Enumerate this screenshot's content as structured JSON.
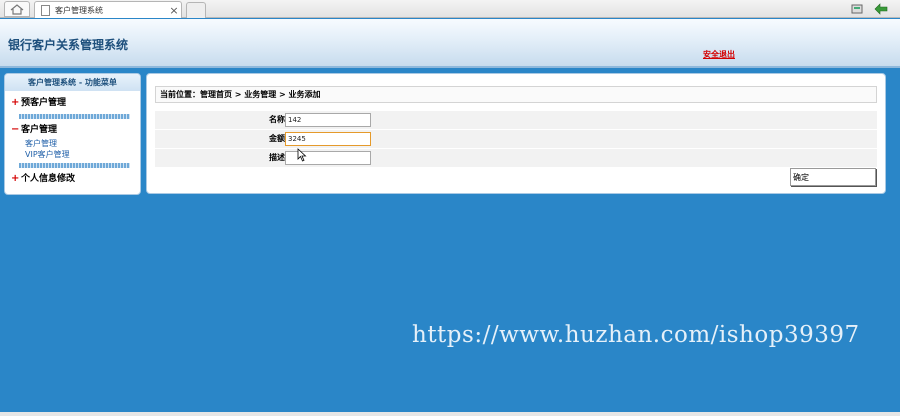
{
  "browser": {
    "tab_title": "客户管理系统",
    "icons": [
      "home-icon",
      "page-icon",
      "close-icon",
      "new-tab-icon",
      "tools-icon",
      "back-icon"
    ]
  },
  "header": {
    "app_title": "银行客户关系管理系统",
    "logout_label": "安全退出"
  },
  "sidebar": {
    "title": "客户管理系统 - 功能菜单",
    "groups": [
      {
        "sign": "+",
        "label": "预客户管理",
        "items": []
      },
      {
        "sign": "−",
        "label": "客户管理",
        "items": [
          "客户管理",
          "VIP客户管理"
        ]
      },
      {
        "sign": "+",
        "label": "个人信息修改",
        "items": []
      }
    ]
  },
  "main": {
    "breadcrumb": "当前位置：管理首页 > 业务管理 > 业务添加",
    "form": {
      "fields": [
        {
          "label": "名称",
          "value": "142"
        },
        {
          "label": "金额",
          "value": "3245"
        },
        {
          "label": "描述",
          "value": ""
        }
      ],
      "submit_label": "确定"
    }
  },
  "watermark": "https://www.huzhan.com/ishop39397",
  "colors": {
    "background": "#2a86c8",
    "logout": "#d40000",
    "link": "#1f5fa8",
    "focus_border": "#e59a2b"
  }
}
